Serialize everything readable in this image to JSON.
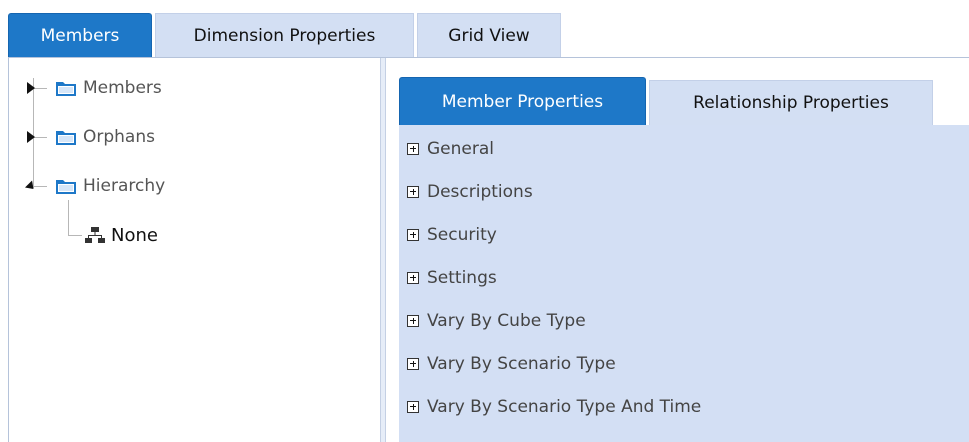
{
  "top_tabs": [
    {
      "label": "Members",
      "active": true
    },
    {
      "label": "Dimension Properties",
      "active": false
    },
    {
      "label": "Grid View",
      "active": false
    }
  ],
  "tree": {
    "nodes": [
      {
        "label": "Members",
        "icon": "folder-icon",
        "expanded": false
      },
      {
        "label": "Orphans",
        "icon": "folder-icon",
        "expanded": false
      },
      {
        "label": "Hierarchy",
        "icon": "folder-icon",
        "expanded": true
      },
      {
        "label": "None",
        "icon": "hierarchy-icon",
        "child": true
      }
    ]
  },
  "sub_tabs": [
    {
      "label": "Member Properties",
      "active": true
    },
    {
      "label": "Relationship Properties",
      "active": false
    }
  ],
  "property_groups": [
    "General",
    "Descriptions",
    "Security",
    "Settings",
    "Vary By Cube Type",
    "Vary By Scenario Type",
    "Vary By Scenario Type And Time"
  ],
  "colors": {
    "accent": "#1e78c8",
    "tab_inactive": "#d3dff3",
    "panel_bg": "#d3dff4"
  }
}
